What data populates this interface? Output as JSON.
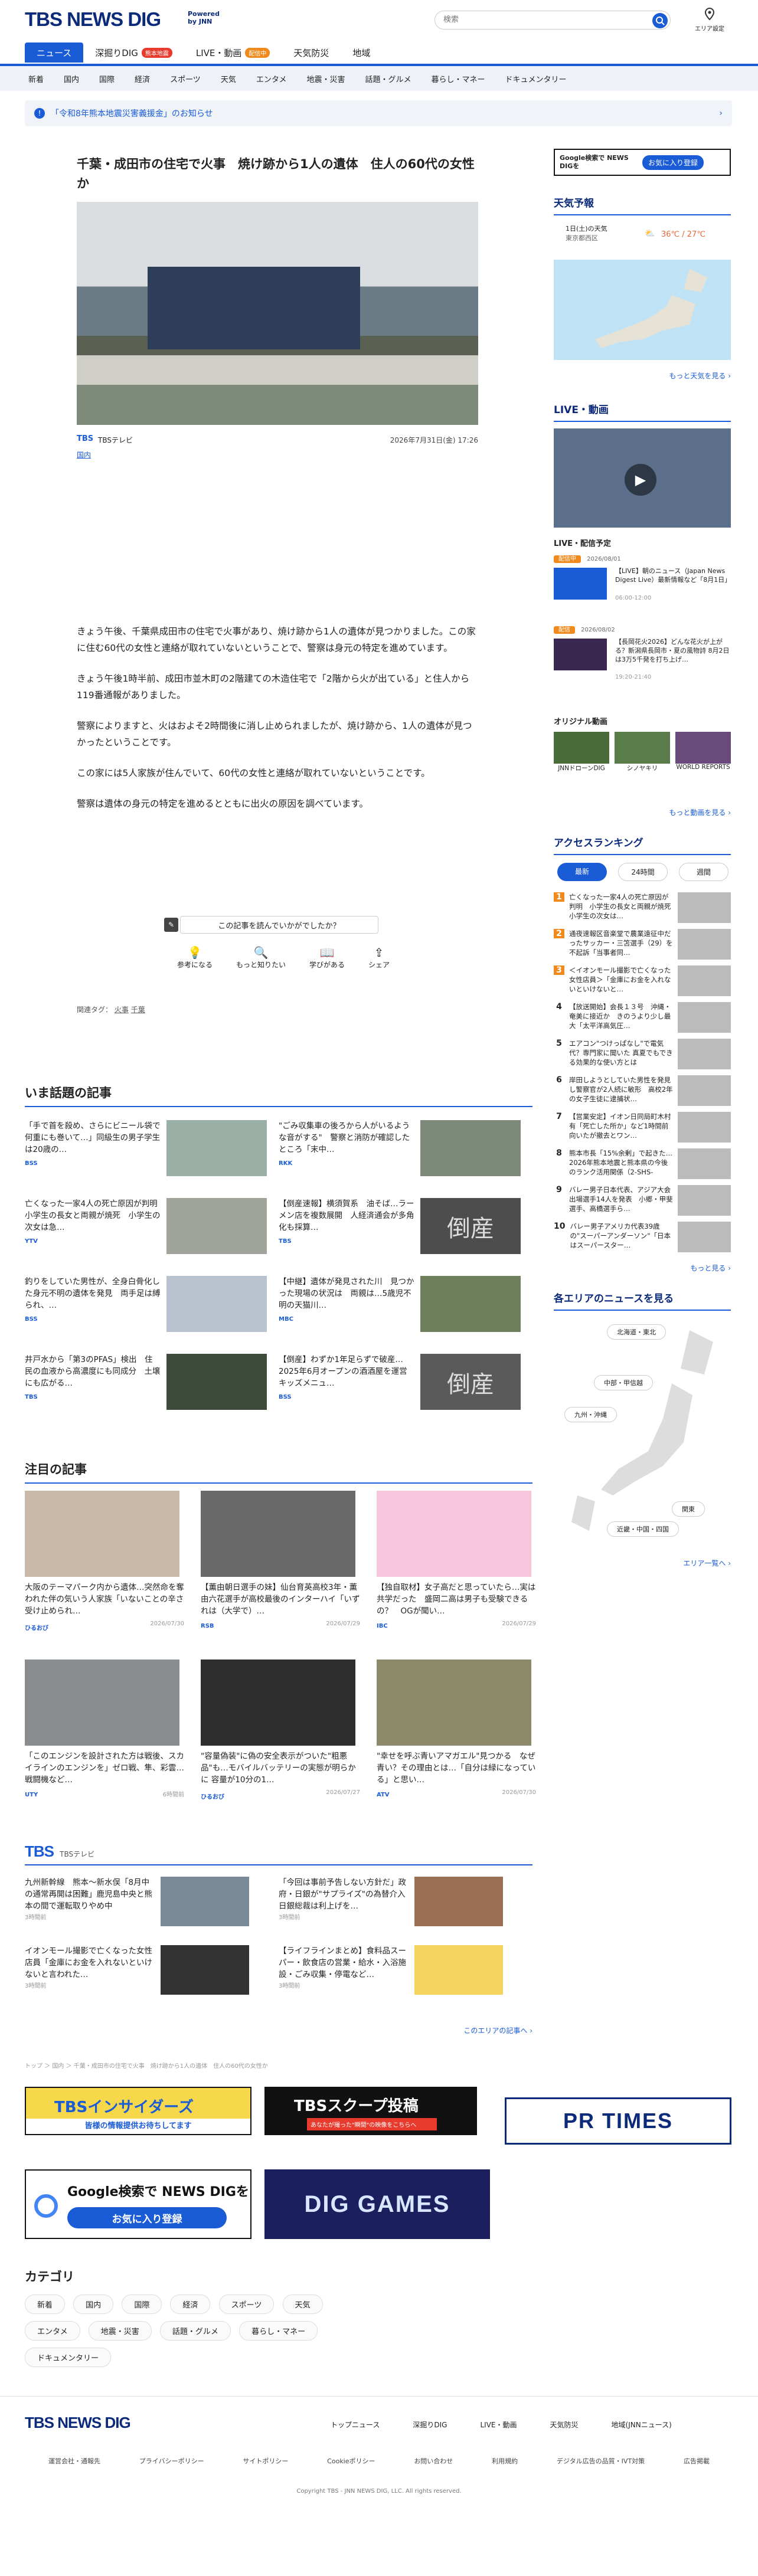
{
  "header": {
    "logo_text": "TBS NEWS DIG",
    "powered": "Powered by JNN",
    "search_placeholder": "検索",
    "area_label": "エリア設定"
  },
  "nav": [
    {
      "label": "ニュース",
      "active": true
    },
    {
      "label": "深掘りDIG",
      "badge": "熊本地震"
    },
    {
      "label": "LIVE・動画",
      "badge": "配信中"
    },
    {
      "label": "天気防災"
    },
    {
      "label": "地域"
    }
  ],
  "subnav": [
    "新着",
    "国内",
    "国際",
    "経済",
    "スポーツ",
    "天気",
    "エンタメ",
    "地震・災害",
    "話題・グルメ",
    "暮らし・マネー",
    "ドキュメンタリー"
  ],
  "notice": "「令和8年熊本地震災害義援金」のお知らせ",
  "article": {
    "title": "千葉・成田市の住宅で火事　焼け跡から1人の遺体　住人の60代の女性か",
    "source": "TBSテレビ",
    "category": "国内",
    "date": "2026年7月31日(金) 17:26",
    "paragraphs": [
      "きょう午後、千葉県成田市の住宅で火事があり、焼け跡から1人の遺体が見つかりました。この家に住む60代の女性と連絡が取れていないということで、警察は身元の特定を進めています。",
      "きょう午後1時半前、成田市並木町の2階建ての木造住宅で「2階から火が出ている」と住人から119番通報がありました。",
      "警察によりますと、火はおよそ2時間後に消し止められましたが、焼け跡から、1人の遺体が見つかったということです。",
      "この家には5人家族が住んでいて、60代の女性と連絡が取れていないということです。",
      "警察は遺体の身元の特定を進めるとともに出火の原因を調べています。"
    ],
    "feedback_question": "この記事を読んでいかがでしたか？",
    "reactions": [
      "参考になる",
      "もっと知りたい",
      "学びがある",
      "シェア"
    ],
    "tags_label": "関連タグ：",
    "tags": [
      "火事",
      "千葉"
    ]
  },
  "hot_section": {
    "title": "いま話題の記事",
    "items": [
      {
        "text": "「手で首を殺め、さらにビニール袋で何重にも巻いて…」同級生の男子学生は20歳の…",
        "src": "BSS",
        "date": "2026/07/30"
      },
      {
        "text": "\"ごみ収集車の後ろから人がいるような音がする\"　警察と消防が確認したところ「末中…",
        "src": "RKK",
        "date": "2026/07/30"
      },
      {
        "text": "亡くなった一家4人の死亡原因が判明　小学生の長女と両親が焼死　小学生の次女は急…",
        "src": "YTV",
        "date": "2026/07/30"
      },
      {
        "text": "【倒産速報】横須賀系　油そば…ラーメン店を複数展開　人経済通会が多角化も採算…",
        "src": "TBS",
        "date": "2026/07/30"
      },
      {
        "text": "釣りをしていた男性が、全身白骨化した身元不明の遺体を発見　両手足は縛られ、…",
        "src": "BSS",
        "date": "2026/07/30"
      },
      {
        "text": "【中継】遺体が発見された川　見つかった現場の状況は　両親は…5歳児不明の天猫川…",
        "src": "MBC",
        "date": "2026/07/30"
      },
      {
        "text": "井戸水から「第3のPFAS」検出　住民の血液から高濃度にも同成分　土壌にも広がる…",
        "src": "TBS",
        "date": "2026/07/30"
      },
      {
        "text": "【倒産】わずか1年足らずで破産…2025年6月オープンの酒酒屋を運営　キッズメニュ…",
        "src": "BSS",
        "date": "2026/07/30"
      }
    ]
  },
  "featured": {
    "title": "注目の記事",
    "items": [
      {
        "text": "大阪のテーマパーク内から遺体…突然命を奪われた伴の気いう人家族「いないことの辛さ受け止められ…",
        "src": "ひるおび",
        "date": "2026/07/30"
      },
      {
        "text": "【薫由朝日選手の妹】仙台育英高校3年・薫由六花選手が高校最後のインターハイ「いずれは（大学で）…",
        "src": "RSB",
        "date": "2026/07/29"
      },
      {
        "text": "【独自取材】女子高だと思っていたら…実は共学だった　盛岡二高は男子も受験できるの？　OGが聞い…",
        "src": "IBC",
        "date": "2026/07/29"
      },
      {
        "text": "「このエンジンを設計された方は戦後、スカイラインのエンジンを」ゼロ戦、隼、彩雲…　戦闘機など…",
        "src": "UTY",
        "date": "6時間前"
      },
      {
        "text": "\"容量偽装\"に偽の安全表示がついた\"粗悪品\"も…モバイルバッテリーの実態が明らかに 容量が10分の1…",
        "src": "ひるおび",
        "date": "2026/07/27"
      },
      {
        "text": "\"幸せを呼ぶ青いアマガエル\"見つかる　なぜ青い？その理由とは…「自分は緑になっている」と思い…",
        "src": "ATV",
        "date": "2026/07/30"
      }
    ]
  },
  "tbs_block": {
    "label": "TBS",
    "sub": "TBSテレビ",
    "items": [
      {
        "text": "九州新幹線　熊本～新水俣「8月中の通常再開は困難」鹿児島中央と熊本の間で運転取りやめ中",
        "date": "3時間前"
      },
      {
        "text": "「今回は事前予告しない方針だ」政府・日銀が\"サプライズ\"の為替介入　日銀総裁は利上げを…",
        "date": "3時間前"
      },
      {
        "text": "イオンモール撮影で亡くなった女性店員「金庫にお金を入れないといけないと言われた…",
        "date": "3時間前"
      },
      {
        "text": "【ライフラインまとめ】食料品スーパー・飲食店の営業・給水・入浴施設・ごみ収集・停電など…",
        "date": "3時間前"
      }
    ],
    "more": "このエリアの記事へ"
  },
  "breadcrumb": "トップ ＞ 国内 ＞ 千葉・成田市の住宅で火事　焼け跡から1人の遺体　住人の60代の女性か",
  "banners": {
    "insiders": "TBSインサイダーズ",
    "insiders_sub": "皆様の情報提供お待ちしてます",
    "scoop": "TBSスクープ投稿",
    "scoop_sub": "あなたが撮った\"瞬間\"の映像をこちらへ",
    "prtimes": "PR TIMES",
    "google_title": "Google検索で NEWS DIGを",
    "google_btn": "お気に入り登録",
    "games": "DIG GAMES"
  },
  "categories": {
    "title": "カテゴリ",
    "items": [
      "新着",
      "国内",
      "国際",
      "経済",
      "スポーツ",
      "天気",
      "エンタメ",
      "地震・災害",
      "話題・グルメ",
      "暮らし・マネー",
      "ドキュメンタリー"
    ]
  },
  "sidebar": {
    "google_text": "Google検索で NEWS DIGを",
    "google_btn": "お気に入り登録",
    "weather_title": "天気予報",
    "weather_date": "1日(土)の天気",
    "weather_place": "東京都西区",
    "weather_temp": "36℃ / 27℃",
    "weather_more": "もっと天気を見る",
    "live_title": "LIVE・動画",
    "live_schedule_title": "LIVE・配信予定",
    "live_items": [
      {
        "badge": "配信中",
        "date": "2026/08/01",
        "text": "【LIVE】朝のニュース（Japan News Digest Live）最新情報など「8月1日」",
        "time": "06:00-12:00"
      },
      {
        "badge": "配信",
        "date": "2026/08/02",
        "text": "【長岡花火2026】どんな花火が上がる？新潟県長岡市・夏の風物詩 8月2日は3万5千発を打ち上げ…",
        "time": "19:20-21:40"
      }
    ],
    "original_title": "オリジナル動画",
    "originals": [
      "JNNドローンDIG",
      "シノヤキリ",
      "WORLD REPORTS"
    ],
    "video_more": "もっと動画を見る",
    "ranking_title": "アクセスランキング",
    "ranking_tabs": [
      "最新",
      "24時間",
      "週間"
    ],
    "ranking": [
      "亡くなった一家4人の死亡原因が判明　小学生の長女と両親が焼死　小学生の次女は…",
      "通夜速報区音楽堂で農業遠征中だったサッカー・三笘選手（29）を不起訴「当事者同…",
      "＜イオンモール撮影で亡くなった女性店員＞「金庫にお金を入れないといけないと…",
      "【放送開始】会長１３号　沖縄・奄美に接近か　きのうより少し最大「太平洋高気圧…",
      "エアコン\"つけっぱなし\"で電気代？専門家に聞いた 真夏でもできる効果的な使い方とは",
      "岸田しようとしていた男性を発見し警察官が2人続に敏形　高校2年の女子生徒に逮捕状…",
      "【営業安定】イオン日同局町木村有「死亡した所か」など1時間前向いたが撤去とワン…",
      "熊本市長「15%余剰」で起きた…2026年熊本地震と熊本県の今後のランク活用関係（2-SHS-",
      "バレー男子日本代表、アジア大会出場選手14人を発表　小郷・甲斐選手、高橋選手ら…",
      "バレー男子アメリカ代表39歳の\"スーパーアンダーソン\"「日本はスーパースター…"
    ],
    "ranking_more": "もっと見る",
    "area_title": "各エリアのニュースを見る",
    "areas": [
      "北海道・東北",
      "中部・甲信越",
      "九州・沖縄",
      "関東",
      "近畿・中国・四国"
    ],
    "area_more": "エリア一覧へ"
  },
  "footer": {
    "logo": "TBS NEWS DIG",
    "links": [
      "トップニュース",
      "深掘りDIG",
      "LIVE・動画",
      "天気防災",
      "地域(JNNニュース)"
    ],
    "sublinks": [
      "運営会社・通報先",
      "プライバシーポリシー",
      "サイトポリシー",
      "Cookieポリシー",
      "お問い合わせ",
      "利用規約",
      "デジタル広告の品質・IVT対策",
      "広告掲載"
    ],
    "copyright": "Copyright TBS - JNN NEWS DIG, LLC. All rights reserved."
  },
  "colors": {
    "brand": "#0b2a7a",
    "accent": "#1a5bd6",
    "badge_red": "#e83a2d",
    "badge_orange": "#f08a1c"
  }
}
